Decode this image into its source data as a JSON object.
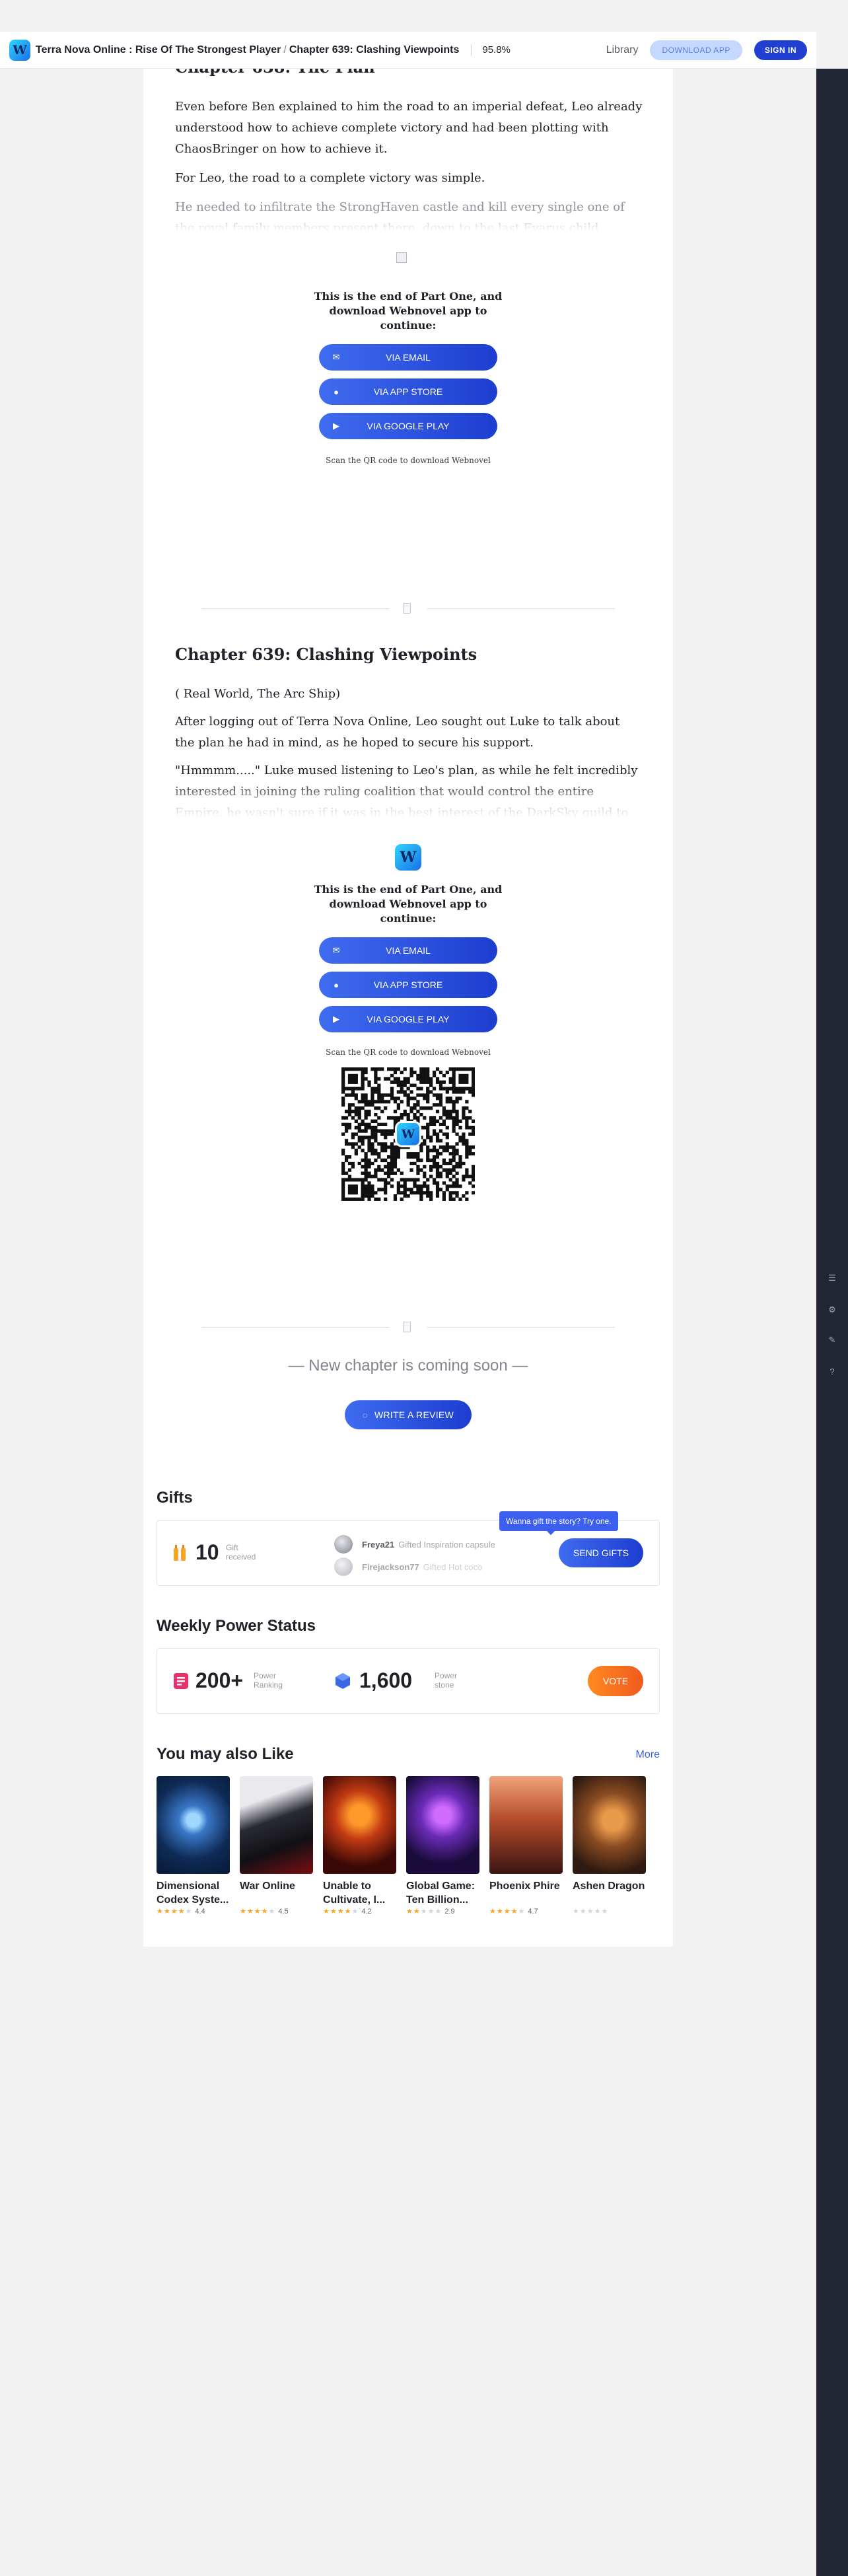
{
  "header": {
    "logo_text": "W",
    "book_title": "Terra Nova Online : Rise Of The Strongest Player",
    "separator": "/",
    "chapter_title": "Chapter 639: Clashing Viewpoints",
    "progress": "95.8%",
    "library": "Library",
    "download_app": "DOWNLOAD APP",
    "sign_in": "SIGN IN"
  },
  "chapter638": {
    "title_partial": "Chapter 638: The Plan",
    "paragraphs": [
      "Even before Ben explained to him the road to an imperial defeat, Leo already understood how to achieve complete victory and had been plotting with ChaosBringer on how to achieve it.",
      "For Leo, the road to a complete victory was simple."
    ],
    "faded": "He needed to infiltrate the StrongHaven castle and kill every single one of the royal family members present there, down to the last Evarus child within."
  },
  "lock_prompt": {
    "title": "This is the end of Part One, and download Webnovel app to continue:",
    "via_email": "VIA EMAIL",
    "via_app_store": "VIA APP STORE",
    "via_google_play": "VIA GOOGLE PLAY",
    "qr_note": "Scan the QR code to download Webnovel"
  },
  "chapter639": {
    "title": "Chapter 639: Clashing Viewpoints",
    "paragraphs": [
      "( Real World, The Arc Ship)",
      "After logging out of Terra Nova Online, Leo sought out Luke to talk about the plan he had in mind, as he hoped to secure his support."
    ],
    "faded": "\"Hmmmm.....\" Luke mused listening to Leo's plan, as while he felt incredibly interested in joining the ruling coalition that would control the entire Empire, he wasn't sure if it was in the best interest of the DarkSky guild to join the"
  },
  "coming_soon": "— New chapter is coming soon —",
  "write_review": "WRITE A REVIEW",
  "gifts": {
    "title": "Gifts",
    "count": "10",
    "count_label_1": "Gift",
    "count_label_2": "received",
    "entries": [
      {
        "user": "Freya21",
        "action": "Gifted Inspiration capsule"
      },
      {
        "user": "Firejackson77",
        "action": "Gifted Hot coco"
      }
    ],
    "tooltip": "Wanna gift the story? Try one.",
    "send": "SEND GIFTS"
  },
  "power": {
    "title": "Weekly Power Status",
    "ranking_value": "200+",
    "ranking_label_1": "Power",
    "ranking_label_2": "Ranking",
    "stone_value": "1,600",
    "stone_label_1": "Power",
    "stone_label_2": "stone",
    "vote": "VOTE"
  },
  "recommend": {
    "title": "You may also Like",
    "more": "More",
    "books": [
      {
        "title": "Dimensional Codex Syste...",
        "rating": "4.4",
        "stars": 4
      },
      {
        "title": "War Online",
        "rating": "4.5",
        "stars": 4
      },
      {
        "title": "Unable to Cultivate, I...",
        "rating": "4.2",
        "stars": 4
      },
      {
        "title": "Global Game: Ten Billion...",
        "rating": "2.9",
        "stars": 2
      },
      {
        "title": "Phoenix Phire",
        "rating": "4.7",
        "stars": 4
      },
      {
        "title": "Ashen Dragon",
        "rating": "",
        "stars": 0
      }
    ]
  },
  "colors": {
    "accent": "#2140d2",
    "vote": "#f5731f",
    "rail": "#232634"
  }
}
